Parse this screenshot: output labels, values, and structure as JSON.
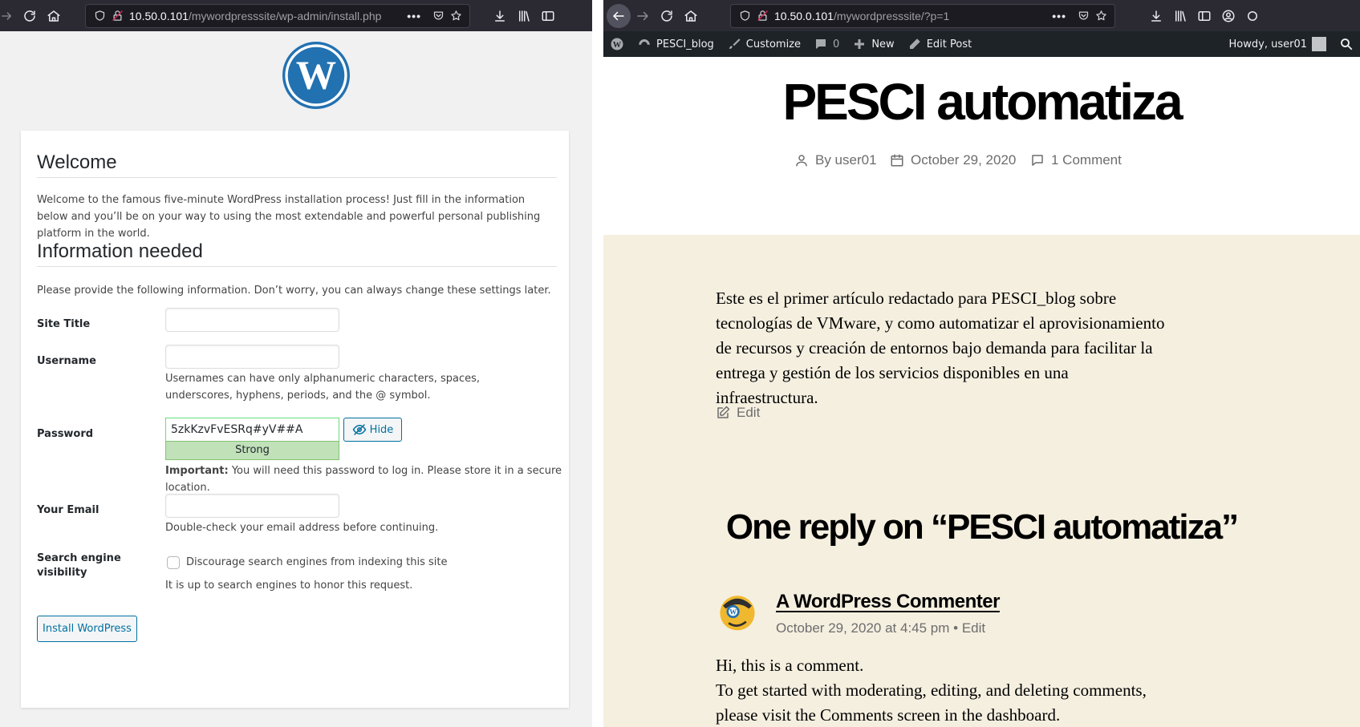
{
  "left_window": {
    "url_host": "10.50.0.101",
    "url_path": "/mywordpresssite/wp-admin/install.php",
    "install": {
      "welcome_heading": "Welcome",
      "welcome_text": "Welcome to the famous five-minute WordPress installation process! Just fill in the information below and you’ll be on your way to using the most extendable and powerful personal publishing platform in the world.",
      "info_heading": "Information needed",
      "info_text": "Please provide the following information. Don’t worry, you can always change these settings later.",
      "site_title_label": "Site Title",
      "site_title_value": "",
      "username_label": "Username",
      "username_value": "",
      "username_hint": "Usernames can have only alphanumeric characters, spaces, underscores, hyphens, periods, and the @ symbol.",
      "password_label": "Password",
      "password_value": "5zkKzvFvESRq#yV##A",
      "password_strength": "Strong",
      "hide_label": "Hide",
      "password_important_bold": "Important:",
      "password_important_text": "You will need this password to log in. Please store it in a secure location.",
      "email_label": "Your Email",
      "email_value": "",
      "email_hint": "Double-check your email address before continuing.",
      "search_label": "Search engine visibility",
      "search_checkbox_label": "Discourage search engines from indexing this site",
      "search_checked": false,
      "search_hint": "It is up to search engines to honor this request.",
      "install_button": "Install WordPress"
    }
  },
  "right_window": {
    "url_host": "10.50.0.101",
    "url_path": "/mywordpresssite/?p=1",
    "admin_bar": {
      "site_name": "PESCI_blog",
      "customize": "Customize",
      "comments_count": "0",
      "new": "New",
      "edit_post": "Edit Post",
      "howdy": "Howdy, user01"
    },
    "post": {
      "title": "PESCI automatiza",
      "author": "By user01",
      "date": "October 29, 2020",
      "comments": "1 Comment",
      "body": "Este es el primer artículo redactado para PESCI_blog sobre tecnologías de VMware, y como automatizar el aprovisionamiento de recursos y creación de entornos bajo demanda para facilitar la entrega y gestión de los servicios disponibles en una infraestructura.",
      "edit": "Edit"
    },
    "comments_section": {
      "heading": "One reply on “PESCI automatiza”",
      "author": "A WordPress Commenter",
      "date_line": "October 29, 2020 at 4:45 pm • Edit",
      "text_line1": "Hi, this is a comment.",
      "text_line2": "To get started with moderating, editing, and deleting comments,",
      "text_line3": "please visit the Comments screen in the dashboard."
    }
  }
}
